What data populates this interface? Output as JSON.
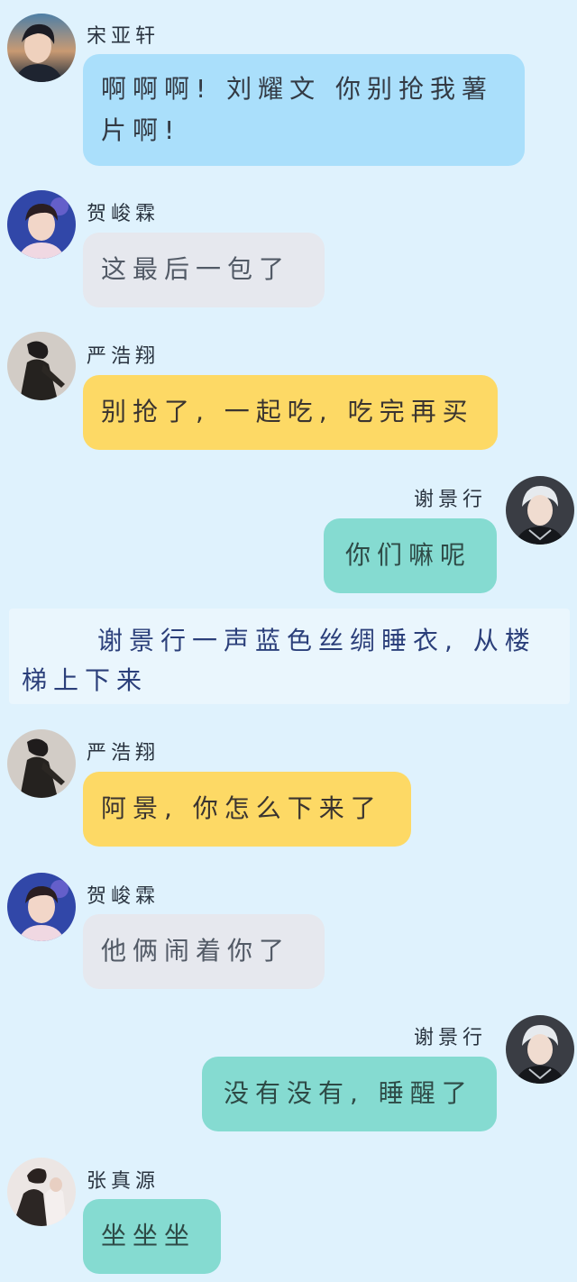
{
  "messages": [
    {
      "side": "left",
      "avatar_icon": "avatar-song",
      "name": "宋亚轩",
      "text": "啊啊啊! 刘耀文 你别抢我薯片啊!",
      "bubble_color": "#aadffb"
    },
    {
      "side": "left",
      "avatar_icon": "avatar-he",
      "name": "贺峻霖",
      "text": "这最后一包了",
      "bubble_color": "#e6e8ee"
    },
    {
      "side": "left",
      "avatar_icon": "avatar-yan",
      "name": "严浩翔",
      "text": "别抢了, 一起吃, 吃完再买",
      "bubble_color": "#fdd965"
    },
    {
      "side": "right",
      "avatar_icon": "avatar-xie",
      "name": "谢景行",
      "text": "你们嘛呢",
      "bubble_color": "#85dbd1"
    },
    {
      "side": "left",
      "avatar_icon": "avatar-yan",
      "name": "严浩翔",
      "text": "阿景, 你怎么下来了",
      "bubble_color": "#fdd965"
    },
    {
      "side": "left",
      "avatar_icon": "avatar-he",
      "name": "贺峻霖",
      "text": "他俩闹着你了",
      "bubble_color": "#e6e8ee"
    },
    {
      "side": "right",
      "avatar_icon": "avatar-xie",
      "name": "谢景行",
      "text": "没有没有, 睡醒了",
      "bubble_color": "#85dbd1"
    },
    {
      "side": "left",
      "avatar_icon": "avatar-zhang",
      "name": "张真源",
      "text": "坐坐坐",
      "bubble_color": "#85dbd1"
    }
  ],
  "narration": {
    "text": "谢景行一声蓝色丝绸睡衣, 从楼梯上下来"
  },
  "colors": {
    "background": "#dff2fd",
    "narration_background": "#eaf6fd",
    "narration_text": "#2b3f7a"
  }
}
